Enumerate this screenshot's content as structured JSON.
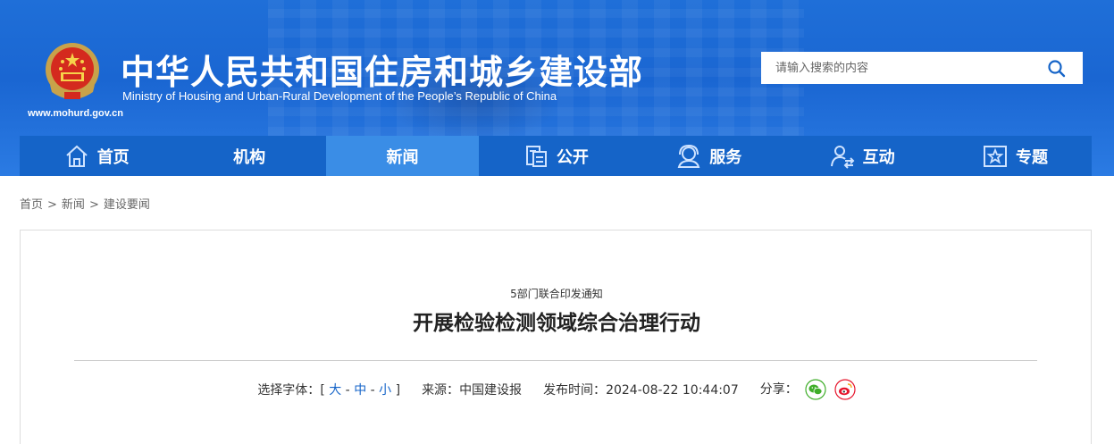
{
  "header": {
    "title": "中华人民共和国住房和城乡建设部",
    "subtitle": "Ministry of Housing and Urban-Rural Development of the People’s Republic of China",
    "url": "www.mohurd.gov.cn",
    "search_placeholder": "请输入搜索的内容",
    "brand_color": "#1a66d2",
    "nav_color": "#1564c8",
    "nav_active_color": "#3a8de6"
  },
  "nav": {
    "items": [
      {
        "label": "首页",
        "icon": "home-icon"
      },
      {
        "label": "机构",
        "icon": ""
      },
      {
        "label": "新闻",
        "icon": "",
        "active": true
      },
      {
        "label": "公开",
        "icon": "disclosure-icon"
      },
      {
        "label": "服务",
        "icon": "service-icon"
      },
      {
        "label": "互动",
        "icon": "interaction-icon"
      },
      {
        "label": "专题",
        "icon": "star-icon"
      }
    ]
  },
  "breadcrumb": {
    "items": [
      "首页",
      "新闻",
      "建设要闻"
    ],
    "separator": ">"
  },
  "article": {
    "pre_title": "5部门联合印发通知",
    "title": "开展检验检测领域综合治理行动",
    "font_size_label": "选择字体：",
    "font_size_open": "[",
    "font_size_close": "]",
    "font_large": "大",
    "font_medium": "中",
    "font_small": "小",
    "font_sep": " - ",
    "source_label": "来源：",
    "source": "中国建设报",
    "publish_label": "发布时间：",
    "publish_time": "2024-08-22 10:44:07",
    "share_label": "分享：",
    "share_icons": [
      "wechat-icon",
      "weibo-icon"
    ]
  }
}
